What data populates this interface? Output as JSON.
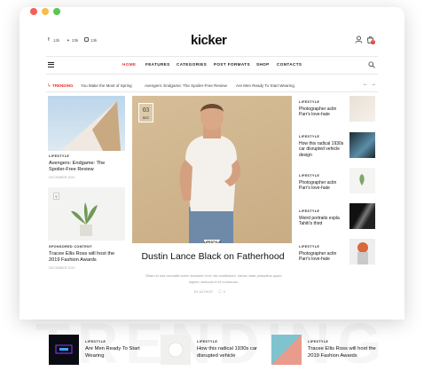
{
  "social": {
    "items": [
      {
        "icon": "facebook-icon",
        "count": "12k"
      },
      {
        "icon": "twitter-icon",
        "count": "23k"
      },
      {
        "icon": "instagram-icon",
        "count": "13k"
      }
    ]
  },
  "brand": {
    "logo": "kicker"
  },
  "nav": {
    "items": [
      "HOME",
      "FEATURES",
      "CATEGORIES",
      "POST FORMATS",
      "SHOP",
      "CONTACTS"
    ],
    "active": "HOME"
  },
  "trending": {
    "label": "TRENDING",
    "items": [
      "You Make the Most of Spring",
      "Avengers: Endgame: The Spoiler-Free Review",
      "Are Men Ready To Start Wearing"
    ]
  },
  "left_posts": [
    {
      "category": "LIFESTYLE",
      "title": "Avengers: Endgame: The Spoiler-Free Review",
      "date": "DECEMBER 2020"
    },
    {
      "category": "SPONSORED CONTENT",
      "title": "Tracee Ellis Ross will host the 2019 Fashion Awards",
      "date": "DECEMBER 2020"
    }
  ],
  "featured": {
    "date_day": "03",
    "date_month": "DEC",
    "category": "LIFESTYLE",
    "title": "Dustin Lance Black on Fatherhood",
    "excerpt": "Etiam id nisl convallis lorem tincidunt et et nisl vestibulum. Varius vitae phasellus quam sapien vehicula in et commodo.",
    "author": "BY AUTHOR",
    "comments": "0"
  },
  "right_posts": [
    {
      "category": "LIFESTYLE",
      "title": "Photographer actin Parr's love-hate"
    },
    {
      "category": "LIFESTYLE",
      "title": "How this radical 1930s car disrupted vehicle design"
    },
    {
      "category": "LIFESTYLE",
      "title": "Photographer actin Parr's love-hate"
    },
    {
      "category": "LIFESTYLE",
      "title": "Weird portraits expla Tahiti's third"
    },
    {
      "category": "LIFESTYLE",
      "title": "Photographer actin Parr's love-hate"
    }
  ],
  "bottom": {
    "ghost_text": "TRENDING",
    "posts": [
      {
        "category": "LIFESTYLE",
        "title": "Are Men Ready To Start Wearing"
      },
      {
        "category": "LIFESTYLE",
        "title": "How this radical 1930s car disrupted vehicle"
      },
      {
        "category": "LIFESTYLE",
        "title": "Tracee Ellis Ross will host the 2019 Fashion Awards"
      }
    ]
  },
  "cart": {
    "count": "0"
  },
  "colors": {
    "accent": "#e8322b",
    "text": "#111111",
    "muted": "#999999"
  }
}
